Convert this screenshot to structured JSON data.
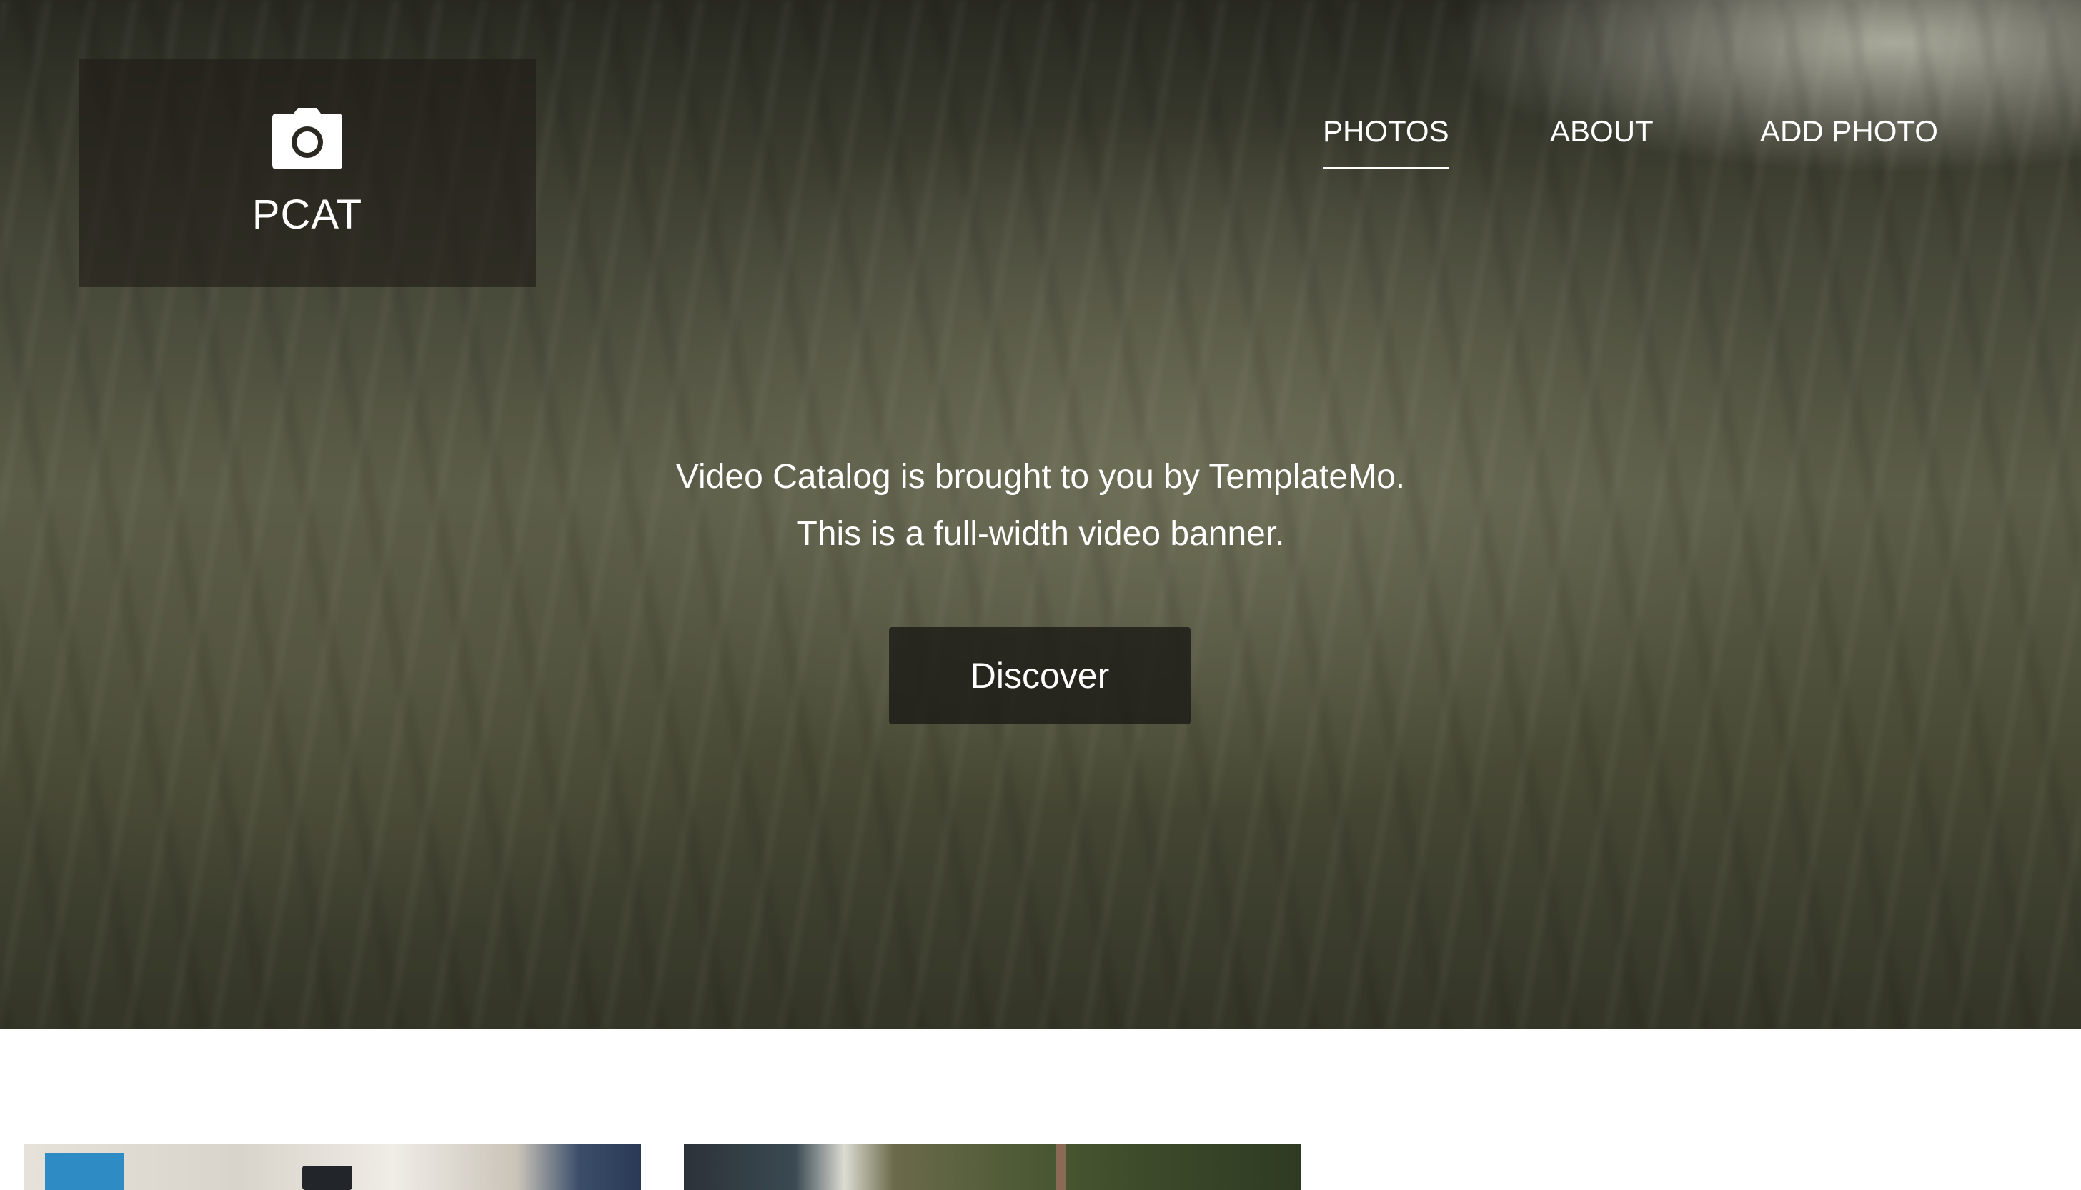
{
  "brand": {
    "icon": "camera-icon",
    "name": "PCAT"
  },
  "nav": {
    "items": [
      {
        "label": "PHOTOS",
        "active": true
      },
      {
        "label": "ABOUT",
        "active": false
      },
      {
        "label": "ADD PHOTO",
        "active": false
      }
    ]
  },
  "hero": {
    "line1": "Video Catalog is brought to you by TemplateMo.",
    "line2": "This is a full-width video banner.",
    "button_label": "Discover"
  },
  "colors": {
    "text": "#ffffff",
    "overlay": "#1e1c16"
  }
}
